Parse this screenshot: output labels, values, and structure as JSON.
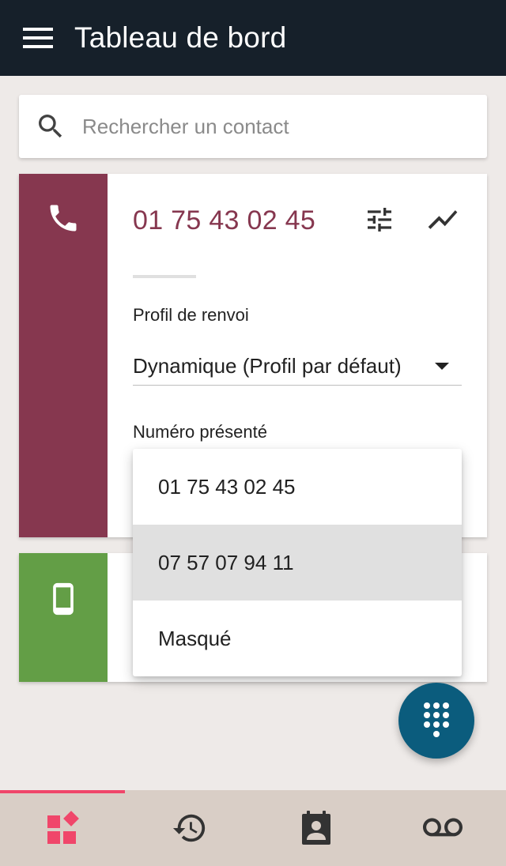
{
  "app_bar": {
    "title": "Tableau de bord",
    "menu_icon": "hamburger-menu-icon"
  },
  "search": {
    "placeholder": "Rechercher un contact",
    "value": "",
    "icon": "search-icon"
  },
  "line_card": {
    "accent_color": "#86374f",
    "icon": "phone-icon",
    "phone_number": "01 75 43 02 45",
    "actions": [
      "tune-icon",
      "trending-icon"
    ],
    "forwarding_profile": {
      "label": "Profil de renvoi",
      "value": "Dynamique (Profil par défaut)"
    },
    "presented_number": {
      "label": "Numéro présenté"
    }
  },
  "presented_number_menu": {
    "options": [
      "01 75 43 02 45",
      "07 57 07 94 11",
      "Masqué"
    ],
    "highlighted": "07 57 07 94 11"
  },
  "mobile_card": {
    "accent_color": "#639e46",
    "icon": "smartphone-icon"
  },
  "fab": {
    "icon": "dialpad-icon",
    "color": "#0b5c7d"
  },
  "bottom_nav": {
    "active_color": "#f0466a",
    "items": [
      {
        "icon": "dashboard-icon",
        "active": true
      },
      {
        "icon": "history-icon",
        "active": false
      },
      {
        "icon": "contacts-icon",
        "active": false
      },
      {
        "icon": "voicemail-icon",
        "active": false
      }
    ]
  }
}
